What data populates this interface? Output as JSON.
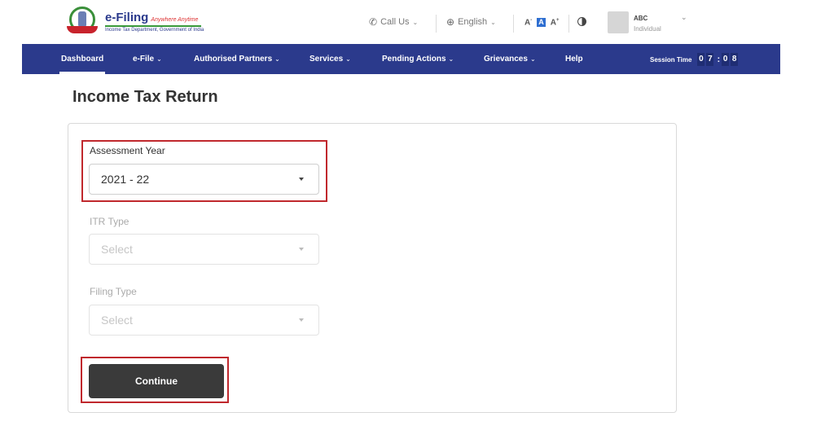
{
  "header": {
    "logo": {
      "title": "e-Filing",
      "tagline": "Anywhere Anytime",
      "subtitle": "Income Tax Department, Government of India"
    },
    "call_us": {
      "label": "Call Us",
      "icon": "phone-icon"
    },
    "language": {
      "label": "English",
      "icon": "globe-icon"
    },
    "font_size": {
      "decrease": "A",
      "default": "A",
      "increase": "A"
    },
    "contrast_icon": "contrast-icon",
    "user": {
      "name": "ABC",
      "role": "Individual"
    }
  },
  "nav": {
    "items": [
      {
        "label": "Dashboard",
        "active": true,
        "dropdown": false
      },
      {
        "label": "e-File",
        "dropdown": true
      },
      {
        "label": "Authorised Partners",
        "dropdown": true
      },
      {
        "label": "Services",
        "dropdown": true
      },
      {
        "label": "Pending Actions",
        "dropdown": true
      },
      {
        "label": "Grievances",
        "dropdown": true
      },
      {
        "label": "Help",
        "dropdown": false
      }
    ],
    "caret": "⌄",
    "session": {
      "label": "Session Time",
      "digits": [
        "0",
        "7",
        "0",
        "8"
      ],
      "separator": ":"
    }
  },
  "page": {
    "title": "Income Tax Return",
    "form": {
      "assessment_year": {
        "label": "Assessment Year",
        "value": "2021 - 22"
      },
      "itr_type": {
        "label": "ITR Type",
        "placeholder": "Select",
        "disabled": true
      },
      "filing_type": {
        "label": "Filing Type",
        "placeholder": "Select",
        "disabled": true
      },
      "continue_label": "Continue"
    }
  },
  "colors": {
    "nav_bg": "#2b3a8c",
    "highlight": "#c0282d",
    "button_bg": "#3a3a3a",
    "accent_blue": "#2f6fd1"
  }
}
